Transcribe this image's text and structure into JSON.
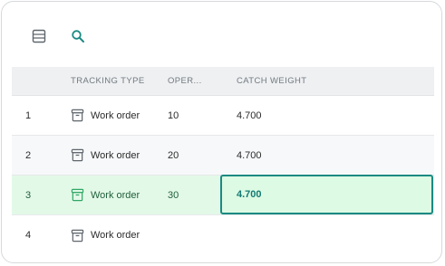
{
  "colors": {
    "accent": "#1a8a82",
    "selected_row_bg": "#e3f9e8",
    "header_bg": "#eef0f2",
    "selected_icon": "#2fa865",
    "icon": "#5f666c"
  },
  "toolbar": {
    "list_icon": "list-icon",
    "search_icon": "search-icon"
  },
  "table": {
    "columns": [
      "",
      "TRACKING TYPE",
      "OPER...",
      "CATCH WEIGHT"
    ],
    "rows": [
      {
        "num": "1",
        "icon": "archive-box-icon",
        "type": "Work order",
        "oper": "10",
        "weight": "4.700"
      },
      {
        "num": "2",
        "icon": "archive-box-icon",
        "type": "Work order",
        "oper": "20",
        "weight": "4.700"
      },
      {
        "num": "3",
        "icon": "archive-box-icon",
        "type": "Work order",
        "oper": "30",
        "weight": "4.700"
      },
      {
        "num": "4",
        "icon": "archive-box-icon",
        "type": "Work order",
        "oper": "",
        "weight": ""
      }
    ]
  }
}
